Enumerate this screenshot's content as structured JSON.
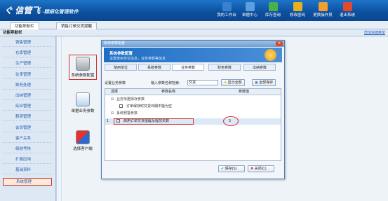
{
  "app": {
    "title": "信管飞",
    "subtitle": "-精细化管理软件"
  },
  "toolbar": [
    {
      "label": "我的工作台",
      "icon": "desktop-icon",
      "color": "#3a7fd0"
    },
    {
      "label": "单据中心",
      "icon": "document-icon",
      "color": "#5aa0e0"
    },
    {
      "label": "库存查询",
      "icon": "stock-icon",
      "color": "#4bb04b"
    },
    {
      "label": "修改密码",
      "icon": "lock-icon",
      "color": "#e8b020"
    },
    {
      "label": "更换操作员",
      "icon": "user-icon",
      "color": "#f0a030"
    },
    {
      "label": "退出系统",
      "icon": "exit-icon",
      "color": "#e04a30"
    }
  ],
  "tabs": [
    {
      "label": "功能导航栏"
    },
    {
      "label": "销售订单交货提醒"
    }
  ],
  "section": {
    "title": "功能导航栏",
    "link": "增加快捷菜单"
  },
  "sidebar": [
    {
      "label": "销售管理"
    },
    {
      "label": "仓库管理"
    },
    {
      "label": "生产管理"
    },
    {
      "label": "往来管理"
    },
    {
      "label": "账务处理"
    },
    {
      "label": "出纳管理"
    },
    {
      "label": "综合管理"
    },
    {
      "label": "薪资管理"
    },
    {
      "label": "会员管理"
    },
    {
      "label": "客户关系"
    },
    {
      "label": "绩效考核"
    },
    {
      "label": "扩展应用"
    },
    {
      "label": "基础资料"
    },
    {
      "label": "系统管理"
    }
  ],
  "cards": [
    {
      "label": "系统参数配置"
    },
    {
      "label": "单据业务参数"
    },
    {
      "label": "选择客户端"
    }
  ],
  "dialog": {
    "title": "系统参数配置",
    "banner_title": "系统参数配置",
    "banner_sub": "设置使用单位信息，业务参数等信息",
    "tabs": [
      "使用单位",
      "系统参数",
      "业务参数",
      "财务参数",
      "出纳参数"
    ],
    "search_label": "设置业务参数",
    "filter_label": "输入参数名称检索:",
    "filter_value": "交货",
    "show_all": "显示全部",
    "save_all": "全部保存",
    "columns": [
      "选择",
      "参数名称",
      "参数值"
    ],
    "group1": "业务单据保存参数",
    "row1": "订单保存时交货日期不能为空",
    "group2": "系统预警参数",
    "row2_index": "1",
    "row2": "启用订单交货提醒及提前天数",
    "row2_value": "3",
    "save_btn": "保存(S)",
    "close_btn": "关闭(C)"
  }
}
